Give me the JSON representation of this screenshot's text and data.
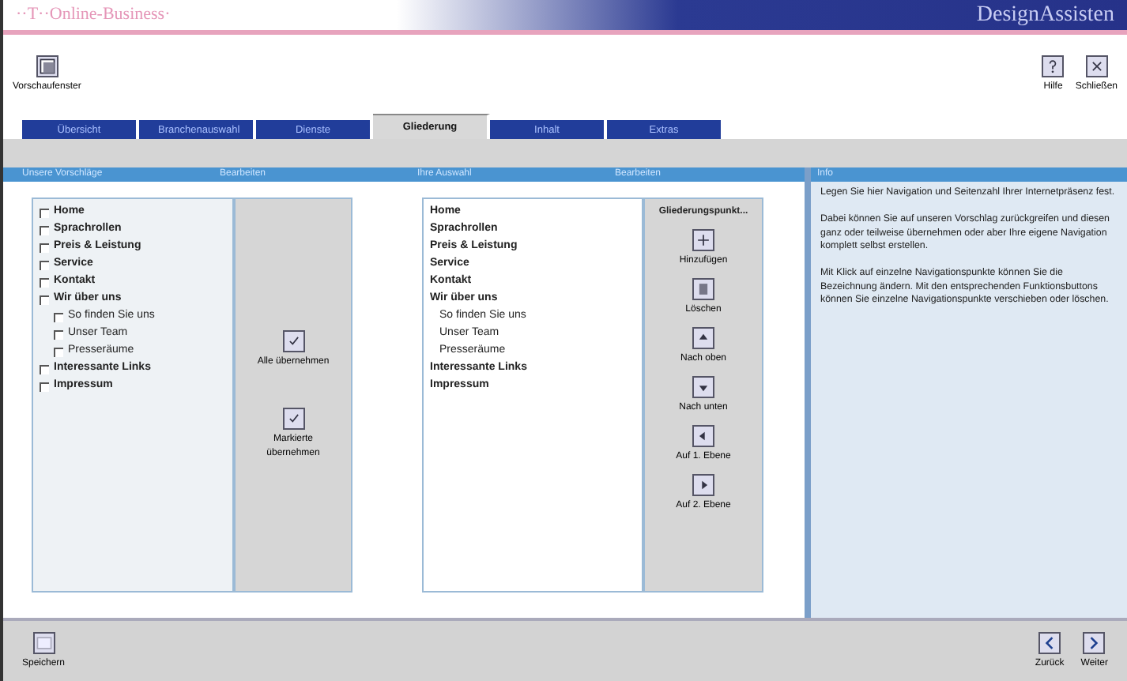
{
  "window": {
    "title": "··T··Online-Business·",
    "product": "DesignAssisten"
  },
  "toolbar": {
    "left": [
      {
        "label": "Vorschaufenster",
        "kind": "preview"
      }
    ],
    "right": [
      {
        "label": "Hilfe",
        "kind": "help"
      },
      {
        "label": "Schließen",
        "kind": "close"
      }
    ]
  },
  "tabs": [
    {
      "label": "Übersicht",
      "selected": false
    },
    {
      "label": "Branchenauswahl",
      "selected": false
    },
    {
      "label": "Dienste",
      "selected": false
    },
    {
      "label": "Gliederung",
      "selected": true
    },
    {
      "label": "Inhalt",
      "selected": false
    },
    {
      "label": "Extras",
      "selected": false
    }
  ],
  "headers": [
    "Unsere Vorschläge",
    "Bearbeiten",
    "Ihre Auswahl",
    "Bearbeiten",
    "Info"
  ],
  "template_tree": [
    {
      "label": "Home",
      "checked": false
    },
    {
      "label": "Sprachrollen",
      "checked": false
    },
    {
      "label": "Preis & Leistung",
      "checked": false
    },
    {
      "label": "Service",
      "checked": false
    },
    {
      "label": "Kontakt",
      "checked": false
    },
    {
      "label": "Wir über uns",
      "checked": false,
      "children": [
        {
          "label": "So finden Sie uns",
          "checked": false
        },
        {
          "label": "Unser Team",
          "checked": false
        },
        {
          "label": "Presseräume",
          "checked": false
        }
      ]
    },
    {
      "label": "Interessante Links",
      "checked": false
    },
    {
      "label": "Impressum",
      "checked": false
    }
  ],
  "copy_buttons": [
    "Alle übernehmen",
    "Markierte übernehmen"
  ],
  "selection_tree": [
    {
      "label": "Home"
    },
    {
      "label": "Sprachrollen"
    },
    {
      "label": "Preis & Leistung"
    },
    {
      "label": "Service"
    },
    {
      "label": "Kontakt"
    },
    {
      "label": "Wir über uns",
      "children": [
        {
          "label": "So finden Sie uns"
        },
        {
          "label": "Unser Team"
        },
        {
          "label": "Presseräume"
        }
      ]
    },
    {
      "label": "Interessante Links"
    },
    {
      "label": "Impressum"
    }
  ],
  "edit_title": "Gliederungspunkt...",
  "edit_buttons": [
    {
      "label": "Hinzufügen",
      "kind": "add"
    },
    {
      "label": "Löschen",
      "kind": "delete"
    },
    {
      "label": "Nach oben",
      "kind": "up"
    },
    {
      "label": "Nach unten",
      "kind": "down"
    },
    {
      "label": "Auf 1. Ebene",
      "kind": "left"
    },
    {
      "label": "Auf 2. Ebene",
      "kind": "right"
    }
  ],
  "info": [
    "Legen Sie hier Navigation und Seitenzahl Ihrer Internetpräsenz fest.",
    "Dabei können Sie auf unseren Vorschlag zurückgreifen und diesen ganz oder teilweise übernehmen oder aber Ihre eigene Navigation komplett selbst erstellen.",
    "Mit Klick auf einzelne Navigationspunkte können Sie die Bezeichnung ändern. Mit den entsprechenden Funktionsbuttons können Sie einzelne Navigationspunkte verschieben oder löschen."
  ],
  "footer": {
    "left": [
      {
        "label": "Speichern",
        "kind": "save"
      }
    ],
    "right": [
      {
        "label": "Zurück",
        "kind": "back"
      },
      {
        "label": "Weiter",
        "kind": "next"
      }
    ]
  }
}
